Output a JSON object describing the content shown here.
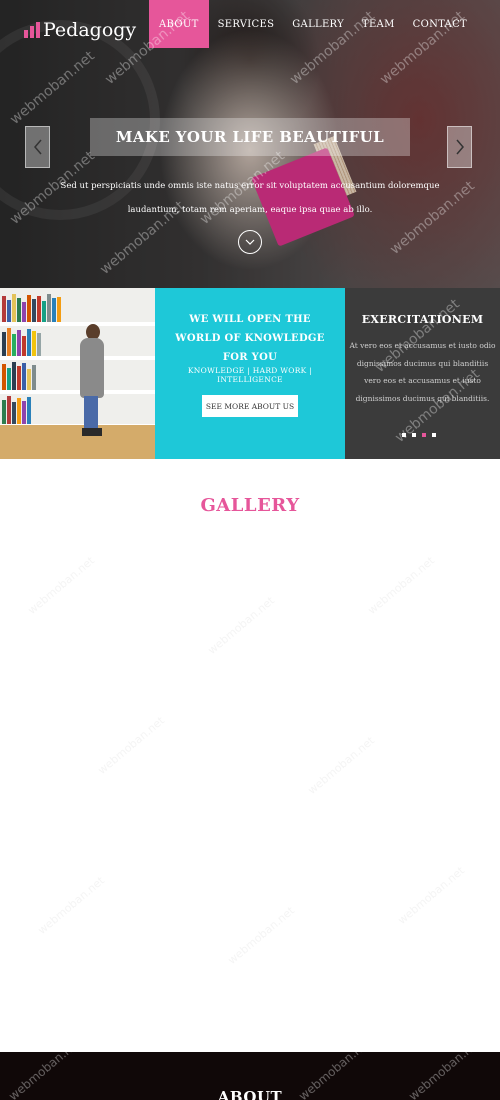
{
  "brand": {
    "name": "Pedagogy",
    "accent": "#e6569a",
    "cyan": "#1ec8d8"
  },
  "nav": {
    "items": [
      {
        "label": "ABOUT",
        "active": true
      },
      {
        "label": "SERVICES",
        "active": false
      },
      {
        "label": "GALLERY",
        "active": false
      },
      {
        "label": "TEAM",
        "active": false
      },
      {
        "label": "CONTACT",
        "active": false
      }
    ]
  },
  "hero": {
    "title": "MAKE YOUR LIFE BEAUTIFUL",
    "subtitle": "Sed ut perspiciatis unde omnis iste natus error sit voluptatem accusantium doloremque laudantium, totam rem aperiam, eaque ipsa quae ab illo.",
    "prev_icon": "chevron-left-icon",
    "next_icon": "chevron-right-icon",
    "scroll_icon": "chevron-down-circle-icon"
  },
  "features": {
    "cyan": {
      "title": "WE WILL OPEN THE WORLD OF KNOWLEDGE FOR YOU",
      "tags": "KNOWLEDGE | HARD WORK | INTELLIGENCE",
      "button": "SEE MORE ABOUT US"
    },
    "dark": {
      "title": "EXERCITATIONEM",
      "text": "At vero eos et accusamus et iusto odio dignissimos ducimus qui blanditiis vero eos et accusamus et iusto dignissimos ducimus qui blanditiis.",
      "dots": [
        false,
        false,
        true,
        false
      ]
    }
  },
  "gallery": {
    "title": "GALLERY"
  },
  "about": {
    "title": "ABOUT"
  },
  "watermark": "webmoban.net"
}
